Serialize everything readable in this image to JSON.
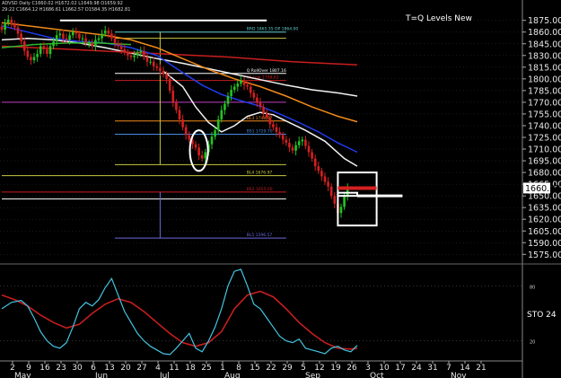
{
  "header": {
    "info_line_1": "ADVSD Daily  C1660.02  H1672.02  L1649.98  O1659.92",
    "info_line_2": "29:22  C1664.12  H1686.61  L1662.57  D1584.35  H1682.81"
  },
  "indicator": {
    "label": "STO 24"
  },
  "colors": {
    "background": "#000000",
    "candle_up": "#22c422",
    "candle_down": "#d42020",
    "ma_white": "#f2f2f2",
    "ma_blue": "#1f3cf0",
    "ma_orange": "#f08a1a",
    "ma_red": "#c81e1e",
    "ma_green": "#2fb32f",
    "stoch_fast": "#44c4e0",
    "stoch_slow": "#c81e1e",
    "highlight": "#ffffff",
    "grid": "#333333"
  },
  "chart_data": {
    "type": "candlestick",
    "title": "T=Q Levels New",
    "ylim": [
      1565,
      1885
    ],
    "y_ticks": [
      1875,
      1860,
      1845,
      1830,
      1815,
      1800,
      1785,
      1770,
      1755,
      1740,
      1725,
      1710,
      1695,
      1680,
      1665,
      1650,
      1635,
      1620,
      1605,
      1590,
      1575
    ],
    "x_ticks": [
      {
        "label": "2",
        "month": "May"
      },
      {
        "label": "9"
      },
      {
        "label": "16"
      },
      {
        "label": "23"
      },
      {
        "label": "30"
      },
      {
        "label": "6",
        "month": "Jun"
      },
      {
        "label": "13"
      },
      {
        "label": "20"
      },
      {
        "label": "27"
      },
      {
        "label": "4",
        "month": "Jul"
      },
      {
        "label": "11"
      },
      {
        "label": "18"
      },
      {
        "label": "25"
      },
      {
        "label": "1",
        "month": "Aug"
      },
      {
        "label": "8"
      },
      {
        "label": "15"
      },
      {
        "label": "22"
      },
      {
        "label": "29"
      },
      {
        "label": "5",
        "month": "Sep"
      },
      {
        "label": "12"
      },
      {
        "label": "19"
      },
      {
        "label": "26"
      },
      {
        "label": "3",
        "month": "Oct"
      },
      {
        "label": "10"
      },
      {
        "label": "17"
      },
      {
        "label": "24"
      },
      {
        "label": "31"
      },
      {
        "label": "7",
        "month": "Nov"
      },
      {
        "label": "14"
      },
      {
        "label": "21"
      }
    ],
    "last_price": "1660.02",
    "closes": [
      1863,
      1872,
      1876,
      1870,
      1866,
      1858,
      1848,
      1836,
      1828,
      1824,
      1828,
      1832,
      1842,
      1838,
      1832,
      1842,
      1848,
      1856,
      1858,
      1852,
      1850,
      1856,
      1860,
      1858,
      1852,
      1852,
      1846,
      1846,
      1842,
      1850,
      1852,
      1858,
      1862,
      1858,
      1852,
      1846,
      1842,
      1838,
      1834,
      1830,
      1828,
      1830,
      1834,
      1836,
      1828,
      1822,
      1822,
      1816,
      1814,
      1810,
      1806,
      1800,
      1785,
      1770,
      1760,
      1748,
      1738,
      1728,
      1722,
      1716,
      1712,
      1702,
      1698,
      1706,
      1716,
      1726,
      1734,
      1748,
      1760,
      1768,
      1778,
      1786,
      1790,
      1794,
      1798,
      1792,
      1790,
      1782,
      1776,
      1770,
      1764,
      1756,
      1750,
      1742,
      1738,
      1732,
      1728,
      1722,
      1718,
      1712,
      1708,
      1715,
      1720,
      1722,
      1714,
      1706,
      1698,
      1688,
      1682,
      1675,
      1668,
      1662,
      1650,
      1640,
      1628,
      1636,
      1650,
      1660
    ],
    "moving_averages": [
      {
        "color_key": "ma_white",
        "values": [
          [
            0,
            1850
          ],
          [
            8,
            1852
          ],
          [
            16,
            1850
          ],
          [
            24,
            1846
          ],
          [
            32,
            1840
          ],
          [
            40,
            1833
          ],
          [
            48,
            1826
          ],
          [
            56,
            1820
          ],
          [
            64,
            1813
          ],
          [
            72,
            1806
          ],
          [
            80,
            1799
          ],
          [
            88,
            1792
          ],
          [
            96,
            1786
          ],
          [
            104,
            1782
          ],
          [
            110,
            1778
          ]
        ]
      },
      {
        "color_key": "ma_red",
        "values": [
          [
            0,
            1842
          ],
          [
            10,
            1840
          ],
          [
            20,
            1838
          ],
          [
            30,
            1836
          ],
          [
            40,
            1834
          ],
          [
            50,
            1832
          ],
          [
            60,
            1830
          ],
          [
            70,
            1828
          ],
          [
            80,
            1825
          ],
          [
            90,
            1822
          ],
          [
            100,
            1820
          ],
          [
            110,
            1818
          ]
        ]
      },
      {
        "color_key": "ma_orange",
        "values": [
          [
            0,
            1872
          ],
          [
            8,
            1868
          ],
          [
            16,
            1864
          ],
          [
            24,
            1860
          ],
          [
            32,
            1856
          ],
          [
            40,
            1850
          ],
          [
            48,
            1840
          ],
          [
            56,
            1826
          ],
          [
            64,
            1812
          ],
          [
            72,
            1800
          ],
          [
            80,
            1790
          ],
          [
            88,
            1778
          ],
          [
            96,
            1764
          ],
          [
            104,
            1752
          ],
          [
            110,
            1745
          ]
        ]
      },
      {
        "color_key": "ma_blue",
        "values": [
          [
            0,
            1868
          ],
          [
            8,
            1860
          ],
          [
            16,
            1852
          ],
          [
            24,
            1848
          ],
          [
            32,
            1846
          ],
          [
            40,
            1840
          ],
          [
            48,
            1830
          ],
          [
            56,
            1808
          ],
          [
            62,
            1792
          ],
          [
            68,
            1780
          ],
          [
            74,
            1772
          ],
          [
            80,
            1765
          ],
          [
            86,
            1755
          ],
          [
            92,
            1744
          ],
          [
            98,
            1732
          ],
          [
            104,
            1718
          ],
          [
            110,
            1706
          ]
        ]
      },
      {
        "color_key": "ma_white",
        "values": [
          [
            50,
            1810
          ],
          [
            56,
            1790
          ],
          [
            60,
            1764
          ],
          [
            64,
            1744
          ],
          [
            68,
            1732
          ],
          [
            72,
            1740
          ],
          [
            76,
            1752
          ],
          [
            80,
            1757
          ],
          [
            84,
            1754
          ],
          [
            88,
            1746
          ],
          [
            94,
            1734
          ],
          [
            100,
            1720
          ],
          [
            106,
            1698
          ],
          [
            110,
            1688
          ]
        ]
      },
      {
        "color_key": "ma_green",
        "values": [
          [
            0,
            1840
          ],
          [
            10,
            1844
          ],
          [
            20,
            1846
          ],
          [
            30,
            1846
          ],
          [
            40,
            1844
          ]
        ]
      }
    ],
    "levels": [
      {
        "price": 1875,
        "color": "#ffffff",
        "start": 18,
        "end": 82,
        "label": ""
      },
      {
        "price": 1860,
        "color": "#5fd0d0",
        "start": 35,
        "end": 88,
        "label": "BRD 1865.35  OP 1864.00"
      },
      {
        "price": 1852,
        "color": "#c8c840",
        "start": 35,
        "end": 88,
        "label": ""
      },
      {
        "price": 1807,
        "color": "#ffffff",
        "start": 35,
        "end": 88,
        "label": "Q RollOver 1807.16"
      },
      {
        "price": 1798,
        "color": "#c81e1e",
        "start": 35,
        "end": 88,
        "label": "LS Low 1798.63"
      },
      {
        "price": 1770,
        "color": "#c040c0",
        "start": 0,
        "end": 88,
        "label": ""
      },
      {
        "price": 1746,
        "color": "#f08a1a",
        "start": 35,
        "end": 88,
        "label": "BL3 1748.97"
      },
      {
        "price": 1729,
        "color": "#4a8ae0",
        "start": 35,
        "end": 88,
        "label": "BS1 1729.70"
      },
      {
        "price": 1690,
        "color": "#c8c840",
        "start": 35,
        "end": 88,
        "label": ""
      },
      {
        "price": 1676,
        "color": "#c8c840",
        "start": 0,
        "end": 88,
        "label": "BL4 1676.97"
      },
      {
        "price": 1655,
        "color": "#c81e1e",
        "start": 0,
        "end": 88,
        "label": "BS2 1655.00"
      },
      {
        "price": 1646,
        "color": "#ffffff",
        "start": 0,
        "end": 88,
        "label": ""
      },
      {
        "price": 1596,
        "color": "#6a6ae0",
        "start": 35,
        "end": 88,
        "label": "BL5 1596.57"
      }
    ],
    "annotations": [
      {
        "type": "ellipse",
        "center_bar": 61,
        "center_price": 1708,
        "half_width_bars": 2,
        "half_height_price": 26
      },
      {
        "type": "box",
        "start_bar": 104,
        "end_bar": 116,
        "high": 1680,
        "low": 1612
      },
      {
        "type": "box",
        "start_bar": 104,
        "end_bar": 110,
        "high": 1654,
        "low": 1650
      },
      {
        "type": "pointer",
        "start_bar": 110,
        "end_bar": 124,
        "price": 1650
      }
    ],
    "indicator": {
      "name": "STO 24",
      "ylim": [
        0,
        100
      ],
      "levels": [
        80,
        20
      ],
      "fast": [
        [
          0,
          55
        ],
        [
          3,
          62
        ],
        [
          6,
          64
        ],
        [
          8,
          58
        ],
        [
          10,
          45
        ],
        [
          12,
          30
        ],
        [
          14,
          20
        ],
        [
          16,
          14
        ],
        [
          18,
          12
        ],
        [
          20,
          18
        ],
        [
          22,
          35
        ],
        [
          24,
          55
        ],
        [
          26,
          62
        ],
        [
          28,
          58
        ],
        [
          30,
          65
        ],
        [
          32,
          78
        ],
        [
          34,
          88
        ],
        [
          36,
          70
        ],
        [
          38,
          52
        ],
        [
          40,
          40
        ],
        [
          42,
          28
        ],
        [
          44,
          20
        ],
        [
          46,
          14
        ],
        [
          48,
          10
        ],
        [
          50,
          6
        ],
        [
          52,
          5
        ],
        [
          54,
          12
        ],
        [
          56,
          20
        ],
        [
          58,
          28
        ],
        [
          60,
          12
        ],
        [
          62,
          8
        ],
        [
          64,
          20
        ],
        [
          66,
          35
        ],
        [
          68,
          55
        ],
        [
          70,
          80
        ],
        [
          72,
          96
        ],
        [
          74,
          98
        ],
        [
          76,
          80
        ],
        [
          78,
          60
        ],
        [
          80,
          55
        ],
        [
          82,
          45
        ],
        [
          84,
          35
        ],
        [
          86,
          25
        ],
        [
          88,
          20
        ],
        [
          90,
          18
        ],
        [
          92,
          22
        ],
        [
          94,
          12
        ],
        [
          96,
          10
        ],
        [
          98,
          8
        ],
        [
          100,
          6
        ],
        [
          102,
          12
        ],
        [
          104,
          14
        ],
        [
          106,
          10
        ],
        [
          108,
          8
        ],
        [
          110,
          15
        ]
      ],
      "slow": [
        [
          0,
          70
        ],
        [
          4,
          65
        ],
        [
          8,
          58
        ],
        [
          12,
          48
        ],
        [
          16,
          40
        ],
        [
          20,
          34
        ],
        [
          24,
          38
        ],
        [
          28,
          50
        ],
        [
          32,
          60
        ],
        [
          36,
          66
        ],
        [
          40,
          62
        ],
        [
          44,
          52
        ],
        [
          48,
          40
        ],
        [
          52,
          28
        ],
        [
          56,
          18
        ],
        [
          60,
          14
        ],
        [
          64,
          18
        ],
        [
          68,
          30
        ],
        [
          72,
          55
        ],
        [
          76,
          70
        ],
        [
          80,
          74
        ],
        [
          84,
          68
        ],
        [
          88,
          55
        ],
        [
          92,
          40
        ],
        [
          96,
          28
        ],
        [
          100,
          18
        ],
        [
          104,
          12
        ],
        [
          108,
          11
        ],
        [
          110,
          12
        ]
      ]
    }
  }
}
